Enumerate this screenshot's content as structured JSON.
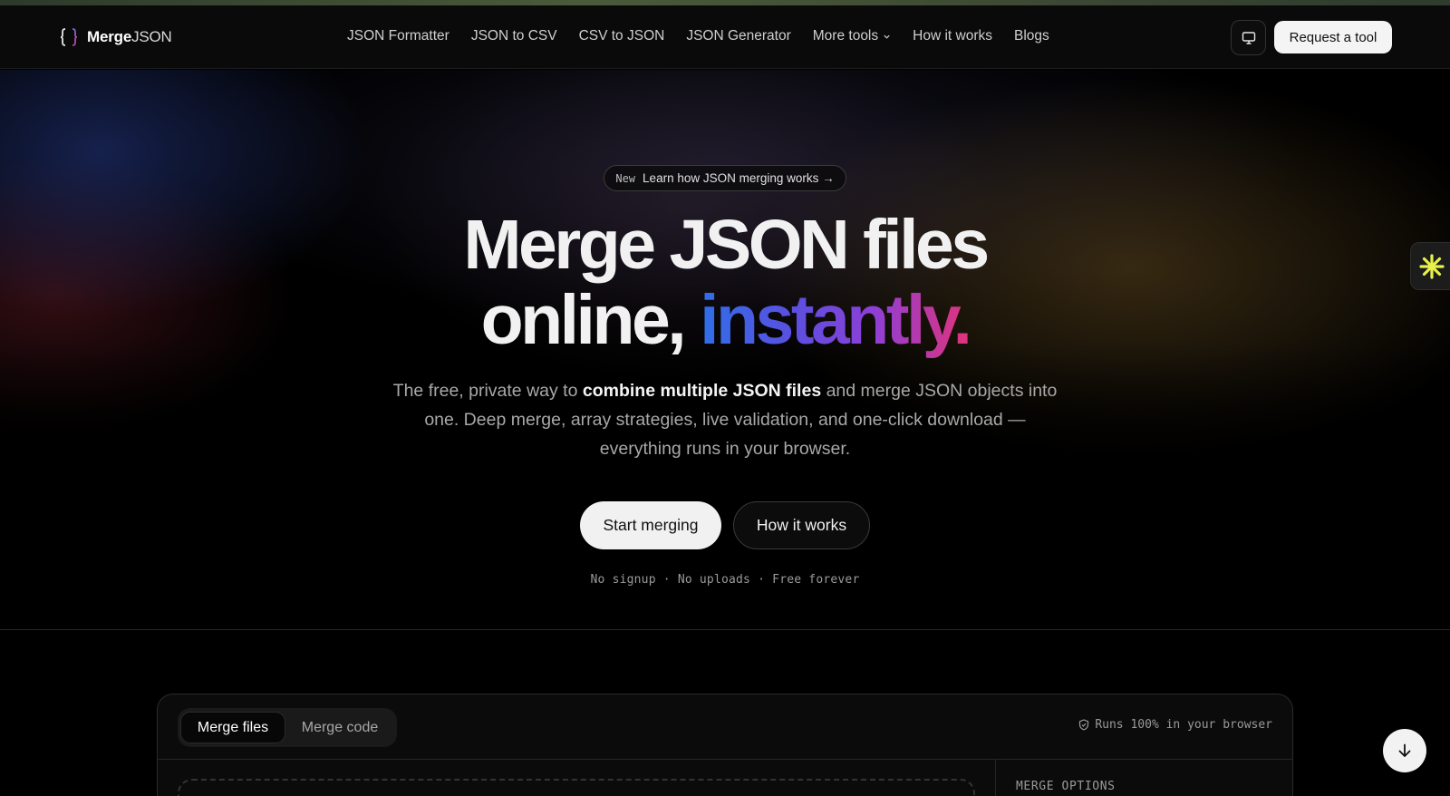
{
  "brand": {
    "name_bold": "Merge",
    "name_light": "JSON"
  },
  "nav": {
    "links": [
      "JSON Formatter",
      "JSON to CSV",
      "CSV to JSON",
      "JSON Generator",
      "More tools",
      "How it works",
      "Blogs"
    ],
    "request_label": "Request a tool"
  },
  "hero": {
    "pill_tag": "New",
    "pill_text": "Learn how JSON merging works →",
    "headline_line1": "Merge JSON files",
    "headline_line2_start": "online, ",
    "headline_line2_accent": "instantly.",
    "subtitle_before": "The free, private way to ",
    "subtitle_bold": "combine multiple JSON files",
    "subtitle_after": " and merge JSON objects into one. Deep merge, array strategies, live validation, and one-click download — everything runs in your browser.",
    "primary_button": "Start merging",
    "secondary_button": "How it works",
    "perks": "No signup · No uploads · Free forever"
  },
  "tool": {
    "tabs": [
      "Merge files",
      "Merge code"
    ],
    "active_tab": "Merge files",
    "runs_note": "Runs 100% in your browser",
    "options_heading": "MERGE OPTIONS"
  },
  "colors": {
    "accent_blue": "#2f6fe8",
    "accent_purple": "#8f3fd6",
    "accent_pink": "#e0337a",
    "widget_yellow": "#e8f04a"
  }
}
